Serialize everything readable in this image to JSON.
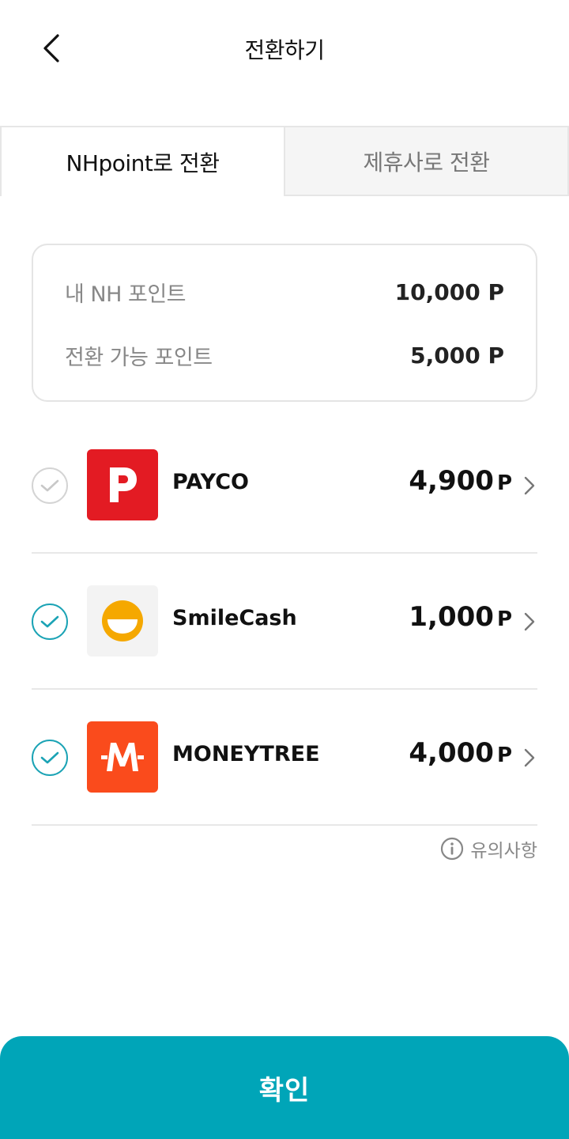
{
  "header": {
    "title": "전환하기"
  },
  "tabs": [
    {
      "label": "NHpoint로 전환",
      "active": true
    },
    {
      "label": "제휴사로 전환",
      "active": false
    }
  ],
  "summary": {
    "my_points_label": "내 NH 포인트",
    "my_points_value": "10,000 P",
    "convertible_label": "전환 가능 포인트",
    "convertible_value": "5,000 P"
  },
  "partners": [
    {
      "name": "PAYCO",
      "points": "4,900",
      "unit": "P",
      "checked": false,
      "logo_icon": "payco-logo-icon",
      "logo_color": "#e31b23"
    },
    {
      "name": "SmileCash",
      "points": "1,000",
      "unit": "P",
      "checked": true,
      "logo_icon": "smilecash-logo-icon",
      "logo_color": "#f5a800"
    },
    {
      "name": "MONEYTREE",
      "points": "4,000",
      "unit": "P",
      "checked": true,
      "logo_icon": "moneytree-logo-icon",
      "logo_color": "#fa4b1c"
    }
  ],
  "notice": {
    "label": "유의사항"
  },
  "confirm": {
    "label": "확인"
  },
  "colors": {
    "accent": "#00a5b8",
    "check_on": "#1ba3b5",
    "check_off": "#d4d4d4"
  }
}
